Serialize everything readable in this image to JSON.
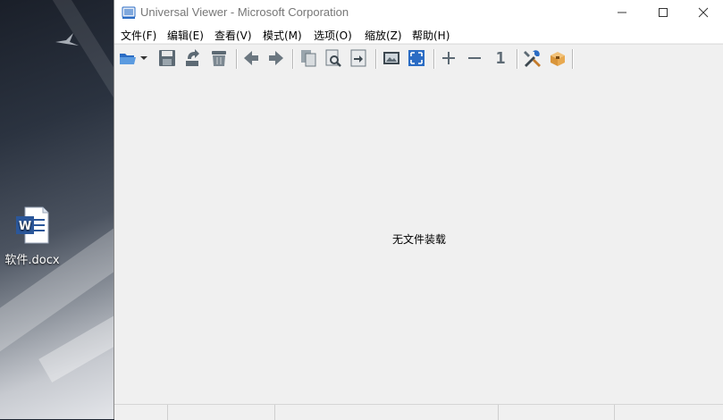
{
  "desktop": {
    "icon_label": "软件.docx"
  },
  "window": {
    "title": "Universal Viewer - Microsoft Corporation",
    "controls": {
      "minimize": "—",
      "maximize": "☐",
      "close": "✕"
    }
  },
  "menu": {
    "items": [
      {
        "label": "文件(F)"
      },
      {
        "label": "编辑(E)"
      },
      {
        "label": "查看(V)"
      },
      {
        "label": "模式(M)"
      },
      {
        "label": "选项(O)"
      },
      {
        "label": "缩放(Z)"
      },
      {
        "label": "帮助(H)"
      }
    ]
  },
  "toolbar": {
    "icons": [
      "open-folder-icon",
      "dropdown-arrow-icon",
      "save-icon",
      "reload-icon",
      "delete-icon",
      "back-icon",
      "forward-icon",
      "copy-icon",
      "find-icon",
      "goto-icon",
      "image-icon",
      "fullscreen-icon",
      "zoom-in-icon",
      "zoom-out-icon",
      "original-size-icon",
      "tools-icon",
      "plugins-icon"
    ],
    "original_size_label": "1"
  },
  "content": {
    "empty_message": "无文件装载"
  },
  "colors": {
    "accent_blue": "#2b6cc4",
    "icon_gray": "#5d6a74",
    "window_bg": "#f0f0f0"
  }
}
